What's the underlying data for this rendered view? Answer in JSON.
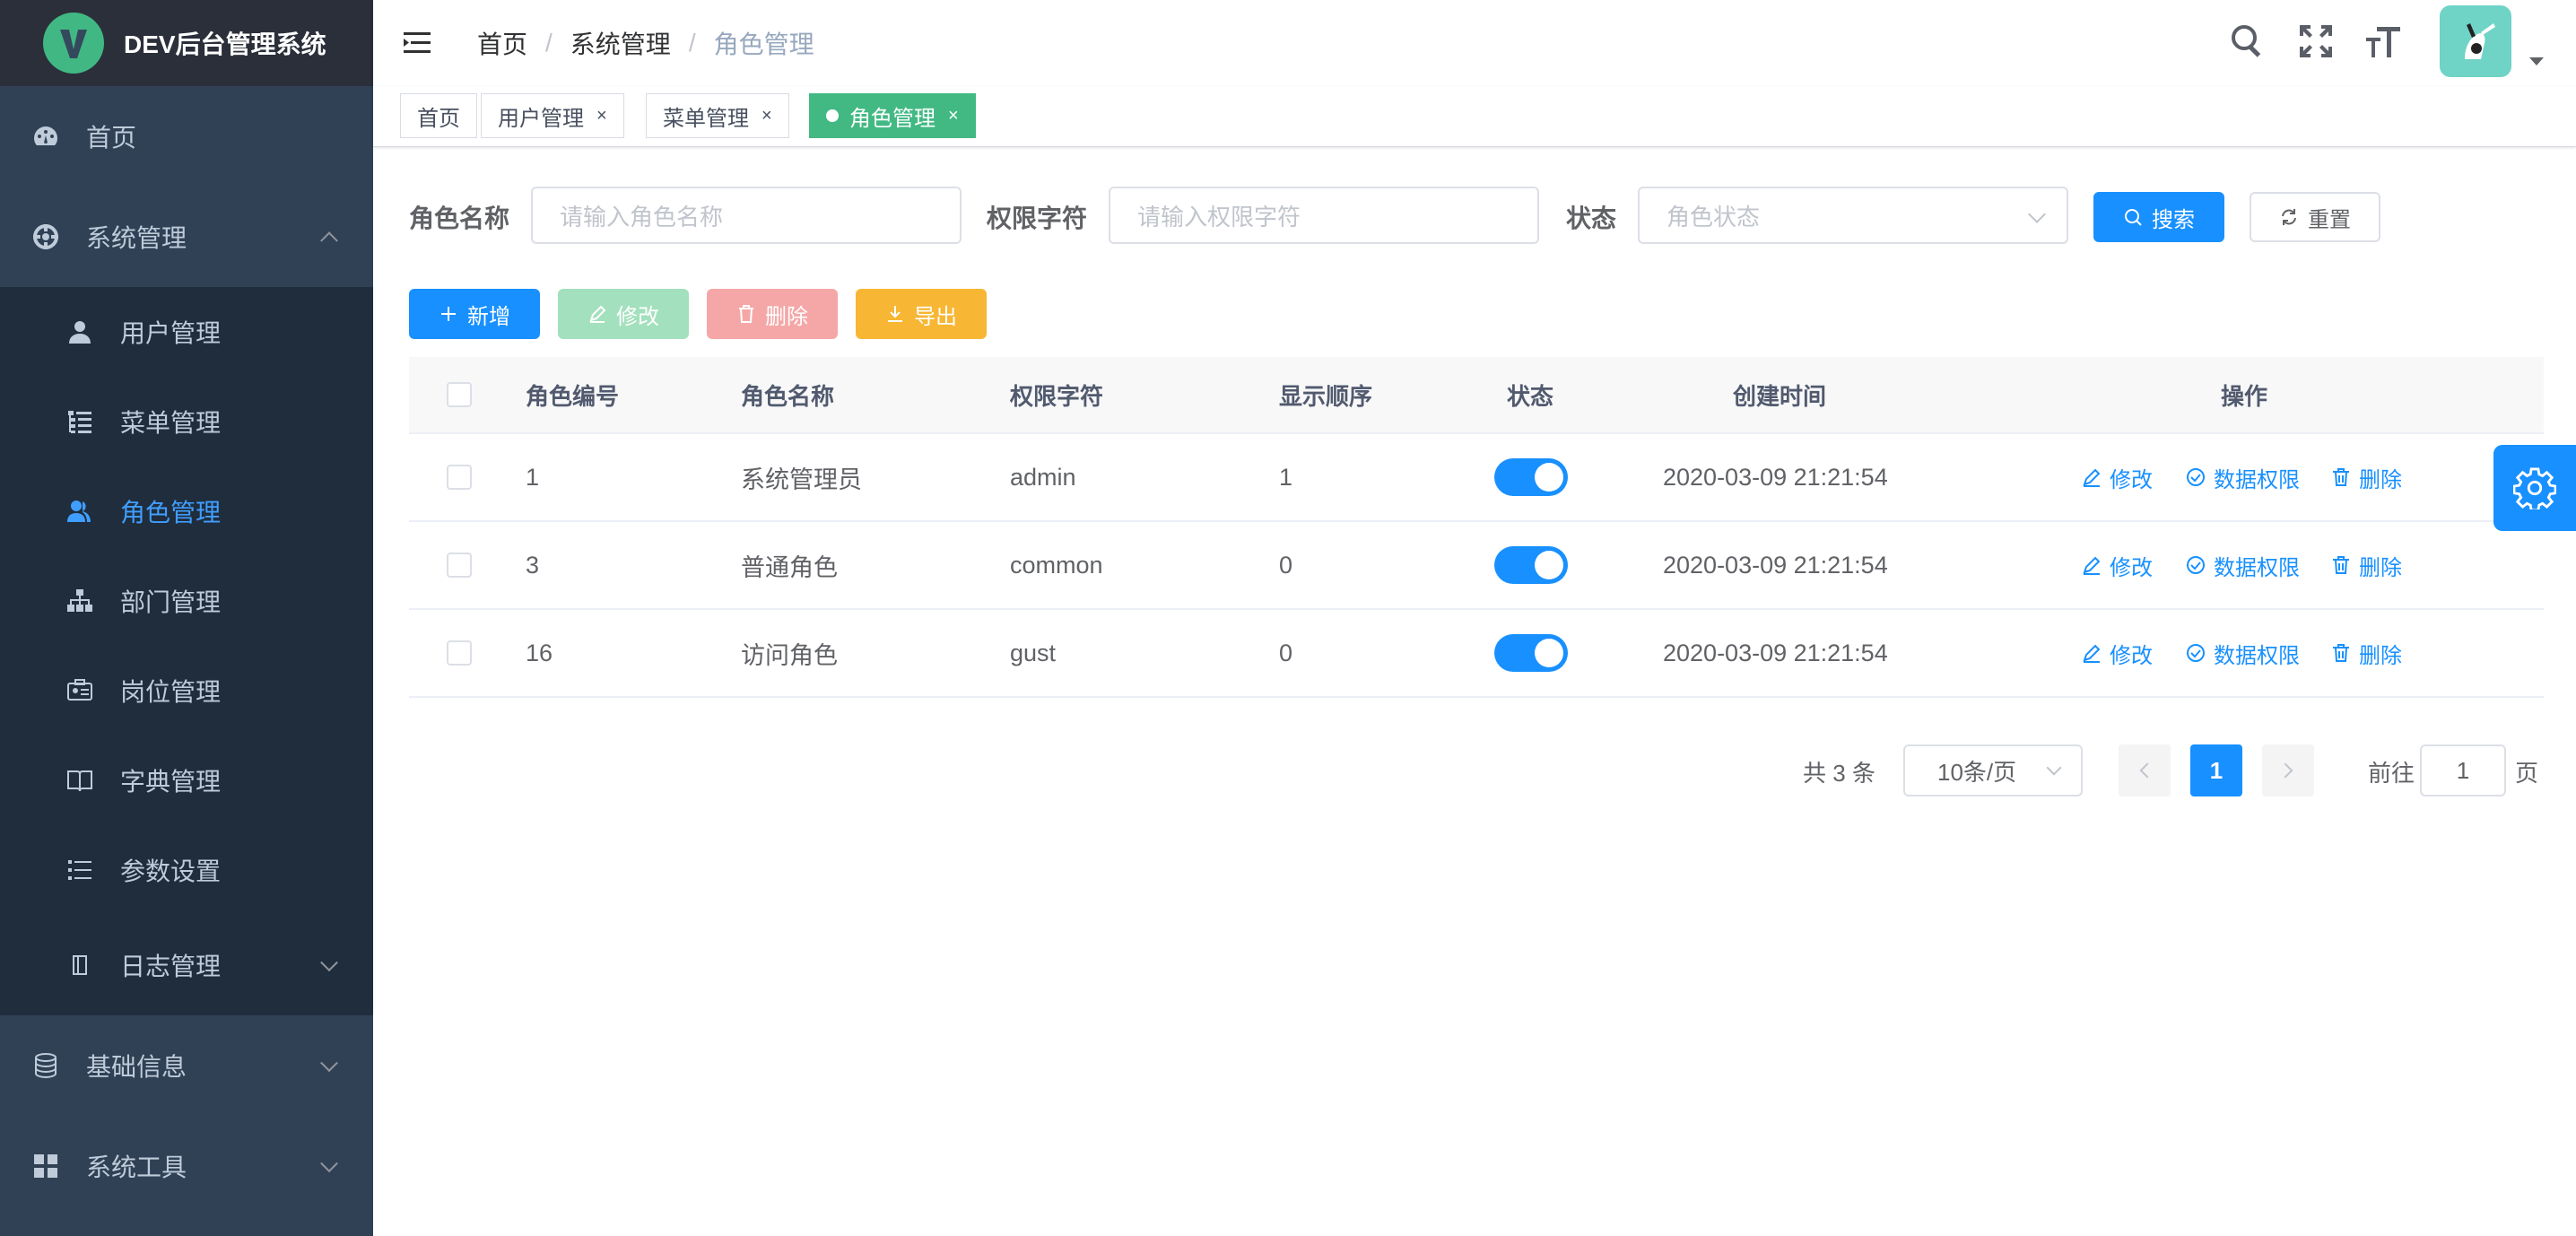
{
  "app": {
    "title": "DEV后台管理系统",
    "logo_letter": "V",
    "accent": "#1890ff",
    "brand_green": "#42b983"
  },
  "sidebar": {
    "items": [
      {
        "label": "首页",
        "icon": "dashboard-icon"
      },
      {
        "label": "系统管理",
        "icon": "system-icon",
        "expanded": true
      },
      {
        "label": "基础信息",
        "icon": "database-icon",
        "expanded": false
      },
      {
        "label": "系统工具",
        "icon": "tools-icon",
        "expanded": false
      }
    ],
    "submenu": [
      {
        "label": "用户管理",
        "icon": "user-icon"
      },
      {
        "label": "菜单管理",
        "icon": "tree-table-icon"
      },
      {
        "label": "角色管理",
        "icon": "peoples-icon",
        "active": true
      },
      {
        "label": "部门管理",
        "icon": "org-tree-icon"
      },
      {
        "label": "岗位管理",
        "icon": "post-icon"
      },
      {
        "label": "字典管理",
        "icon": "book-icon"
      },
      {
        "label": "参数设置",
        "icon": "list-icon"
      },
      {
        "label": "日志管理",
        "icon": "log-icon",
        "expanded": false
      }
    ]
  },
  "header": {
    "breadcrumb": [
      "首页",
      "系统管理",
      "角色管理"
    ],
    "separator": "/"
  },
  "tags": [
    {
      "label": "首页",
      "closable": false
    },
    {
      "label": "用户管理",
      "closable": true
    },
    {
      "label": "菜单管理",
      "closable": true
    },
    {
      "label": "角色管理",
      "closable": true,
      "active": true
    }
  ],
  "tag_close": "×",
  "search": {
    "role_name_label": "角色名称",
    "role_name_placeholder": "请输入角色名称",
    "role_key_label": "权限字符",
    "role_key_placeholder": "请输入权限字符",
    "status_label": "状态",
    "status_placeholder": "角色状态",
    "search_button": "搜索",
    "reset_button": "重置"
  },
  "toolbar": {
    "add": "新增",
    "edit": "修改",
    "delete": "删除",
    "export": "导出",
    "colors": {
      "add": "#1890ff",
      "edit": "#a3e0bd",
      "delete": "#f5a7a7",
      "export": "#f7b633"
    }
  },
  "table": {
    "columns": [
      "角色编号",
      "角色名称",
      "权限字符",
      "显示顺序",
      "状态",
      "创建时间",
      "操作"
    ],
    "rows": [
      {
        "id": "1",
        "name": "系统管理员",
        "key": "admin",
        "sort": "1",
        "enabled": true,
        "created": "2020-03-09 21:21:54"
      },
      {
        "id": "3",
        "name": "普通角色",
        "key": "common",
        "sort": "0",
        "enabled": true,
        "created": "2020-03-09 21:21:54"
      },
      {
        "id": "16",
        "name": "访问角色",
        "key": "gust",
        "sort": "0",
        "enabled": true,
        "created": "2020-03-09 21:21:54"
      }
    ],
    "actions": {
      "edit": "修改",
      "data_scope": "数据权限",
      "delete": "删除"
    }
  },
  "pagination": {
    "total_text": "共 3 条",
    "page_size": "10条/页",
    "current_page": "1",
    "goto_label": "前往",
    "goto_value": "1",
    "page_suffix": "页"
  }
}
